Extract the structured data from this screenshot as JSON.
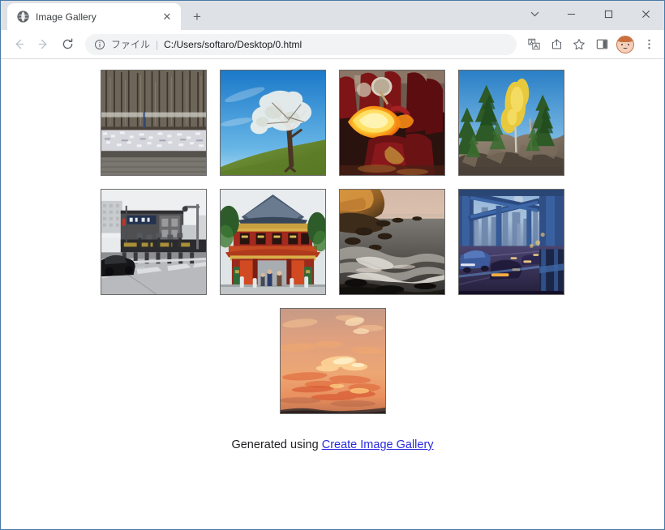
{
  "window": {
    "border_color": "#4a7aa5",
    "controls": {
      "tab_search": "⌄",
      "minimize": "−",
      "maximize": "□",
      "close": "✕"
    }
  },
  "tabs": [
    {
      "title": "Image Gallery",
      "favicon": "globe-icon",
      "close_label": "✕",
      "active": true
    }
  ],
  "new_tab": {
    "label": "+"
  },
  "toolbar": {
    "back_label": "←",
    "forward_label": "→",
    "reload_label": "⟳",
    "omnibox": {
      "info_icon": "info-circle-icon",
      "scheme_label": "ファイル",
      "separator": "|",
      "url": "C:/Users/softaro/Desktop/0.html"
    },
    "translate_label": "translate-icon",
    "share_label": "share-icon",
    "bookmark_label": "star-icon",
    "side_panel_label": "side-panel-icon",
    "profile_label": "profile-avatar",
    "menu_label": "⋮"
  },
  "page": {
    "title": "Image Gallery",
    "rows": [
      [
        {
          "alt": "Snow geese on frozen lake with bare winter forest",
          "key": "winter-geese"
        },
        {
          "alt": "White blossoming tree on green hill under blue sky",
          "key": "blossom-tree"
        },
        {
          "alt": "Fire breathing performer in red robes",
          "key": "fire-breather"
        },
        {
          "alt": "Rocky cliff with pine trees and yellow aspen",
          "key": "rock-pines"
        }
      ],
      [
        {
          "alt": "Japanese street crossing with dark building",
          "key": "street-crossing"
        },
        {
          "alt": "Red Japanese shrine gate with visitors",
          "key": "shrine-gate"
        },
        {
          "alt": "Rocky coastline with surf at dusk",
          "key": "coast-dusk"
        },
        {
          "alt": "Blue steel bridge with motion blurred traffic at twilight",
          "key": "bridge-traffic"
        }
      ],
      [
        {
          "alt": "Orange sunset sky with clouds",
          "key": "sunset-sky"
        }
      ]
    ],
    "footer": {
      "prefix": "Generated using ",
      "link_text": "Create Image Gallery"
    }
  },
  "colors": {
    "tabstrip_bg": "#dee1e6",
    "toolbar_bg": "#ffffff",
    "omnibox_bg": "#f1f3f4",
    "link": "#2a2ae0",
    "thumb_border": "#6b6b6b"
  }
}
